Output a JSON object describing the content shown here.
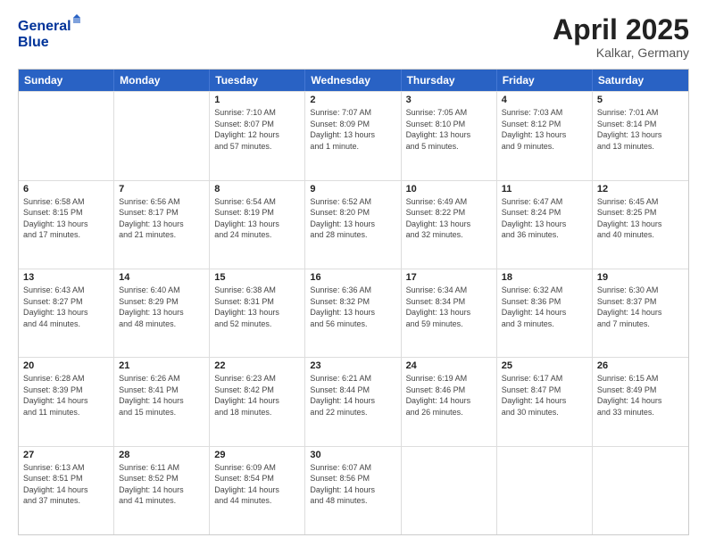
{
  "header": {
    "logo_line1": "General",
    "logo_line2": "Blue",
    "title": "April 2025",
    "location": "Kalkar, Germany"
  },
  "weekdays": [
    "Sunday",
    "Monday",
    "Tuesday",
    "Wednesday",
    "Thursday",
    "Friday",
    "Saturday"
  ],
  "weeks": [
    [
      {
        "day": "",
        "info": ""
      },
      {
        "day": "",
        "info": ""
      },
      {
        "day": "1",
        "info": "Sunrise: 7:10 AM\nSunset: 8:07 PM\nDaylight: 12 hours\nand 57 minutes."
      },
      {
        "day": "2",
        "info": "Sunrise: 7:07 AM\nSunset: 8:09 PM\nDaylight: 13 hours\nand 1 minute."
      },
      {
        "day": "3",
        "info": "Sunrise: 7:05 AM\nSunset: 8:10 PM\nDaylight: 13 hours\nand 5 minutes."
      },
      {
        "day": "4",
        "info": "Sunrise: 7:03 AM\nSunset: 8:12 PM\nDaylight: 13 hours\nand 9 minutes."
      },
      {
        "day": "5",
        "info": "Sunrise: 7:01 AM\nSunset: 8:14 PM\nDaylight: 13 hours\nand 13 minutes."
      }
    ],
    [
      {
        "day": "6",
        "info": "Sunrise: 6:58 AM\nSunset: 8:15 PM\nDaylight: 13 hours\nand 17 minutes."
      },
      {
        "day": "7",
        "info": "Sunrise: 6:56 AM\nSunset: 8:17 PM\nDaylight: 13 hours\nand 21 minutes."
      },
      {
        "day": "8",
        "info": "Sunrise: 6:54 AM\nSunset: 8:19 PM\nDaylight: 13 hours\nand 24 minutes."
      },
      {
        "day": "9",
        "info": "Sunrise: 6:52 AM\nSunset: 8:20 PM\nDaylight: 13 hours\nand 28 minutes."
      },
      {
        "day": "10",
        "info": "Sunrise: 6:49 AM\nSunset: 8:22 PM\nDaylight: 13 hours\nand 32 minutes."
      },
      {
        "day": "11",
        "info": "Sunrise: 6:47 AM\nSunset: 8:24 PM\nDaylight: 13 hours\nand 36 minutes."
      },
      {
        "day": "12",
        "info": "Sunrise: 6:45 AM\nSunset: 8:25 PM\nDaylight: 13 hours\nand 40 minutes."
      }
    ],
    [
      {
        "day": "13",
        "info": "Sunrise: 6:43 AM\nSunset: 8:27 PM\nDaylight: 13 hours\nand 44 minutes."
      },
      {
        "day": "14",
        "info": "Sunrise: 6:40 AM\nSunset: 8:29 PM\nDaylight: 13 hours\nand 48 minutes."
      },
      {
        "day": "15",
        "info": "Sunrise: 6:38 AM\nSunset: 8:31 PM\nDaylight: 13 hours\nand 52 minutes."
      },
      {
        "day": "16",
        "info": "Sunrise: 6:36 AM\nSunset: 8:32 PM\nDaylight: 13 hours\nand 56 minutes."
      },
      {
        "day": "17",
        "info": "Sunrise: 6:34 AM\nSunset: 8:34 PM\nDaylight: 13 hours\nand 59 minutes."
      },
      {
        "day": "18",
        "info": "Sunrise: 6:32 AM\nSunset: 8:36 PM\nDaylight: 14 hours\nand 3 minutes."
      },
      {
        "day": "19",
        "info": "Sunrise: 6:30 AM\nSunset: 8:37 PM\nDaylight: 14 hours\nand 7 minutes."
      }
    ],
    [
      {
        "day": "20",
        "info": "Sunrise: 6:28 AM\nSunset: 8:39 PM\nDaylight: 14 hours\nand 11 minutes."
      },
      {
        "day": "21",
        "info": "Sunrise: 6:26 AM\nSunset: 8:41 PM\nDaylight: 14 hours\nand 15 minutes."
      },
      {
        "day": "22",
        "info": "Sunrise: 6:23 AM\nSunset: 8:42 PM\nDaylight: 14 hours\nand 18 minutes."
      },
      {
        "day": "23",
        "info": "Sunrise: 6:21 AM\nSunset: 8:44 PM\nDaylight: 14 hours\nand 22 minutes."
      },
      {
        "day": "24",
        "info": "Sunrise: 6:19 AM\nSunset: 8:46 PM\nDaylight: 14 hours\nand 26 minutes."
      },
      {
        "day": "25",
        "info": "Sunrise: 6:17 AM\nSunset: 8:47 PM\nDaylight: 14 hours\nand 30 minutes."
      },
      {
        "day": "26",
        "info": "Sunrise: 6:15 AM\nSunset: 8:49 PM\nDaylight: 14 hours\nand 33 minutes."
      }
    ],
    [
      {
        "day": "27",
        "info": "Sunrise: 6:13 AM\nSunset: 8:51 PM\nDaylight: 14 hours\nand 37 minutes."
      },
      {
        "day": "28",
        "info": "Sunrise: 6:11 AM\nSunset: 8:52 PM\nDaylight: 14 hours\nand 41 minutes."
      },
      {
        "day": "29",
        "info": "Sunrise: 6:09 AM\nSunset: 8:54 PM\nDaylight: 14 hours\nand 44 minutes."
      },
      {
        "day": "30",
        "info": "Sunrise: 6:07 AM\nSunset: 8:56 PM\nDaylight: 14 hours\nand 48 minutes."
      },
      {
        "day": "",
        "info": ""
      },
      {
        "day": "",
        "info": ""
      },
      {
        "day": "",
        "info": ""
      }
    ]
  ]
}
